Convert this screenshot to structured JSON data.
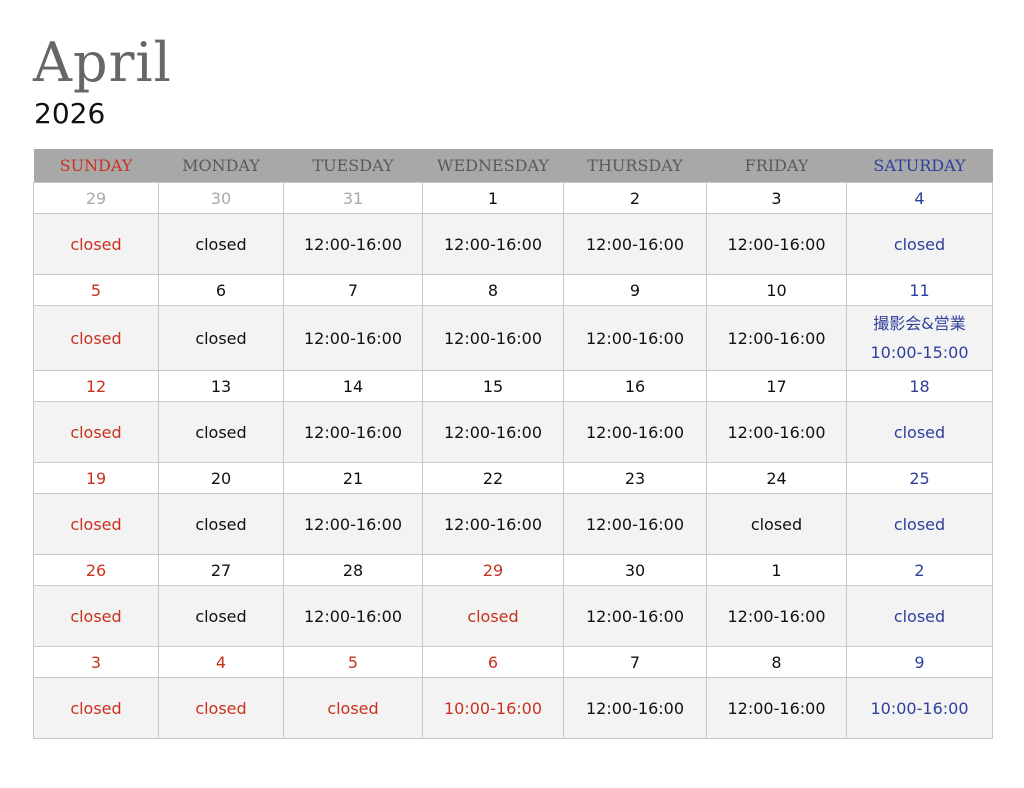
{
  "title": {
    "month": "April",
    "year": "2026"
  },
  "weekdays": [
    "SUNDAY",
    "MONDAY",
    "TUESDAY",
    "WEDNESDAY",
    "THURSDAY",
    "FRIDAY",
    "SATURDAY"
  ],
  "colors": {
    "holiday_red": "#c8321e",
    "saturday_blue": "#2e3f9c",
    "other_month_grey": "#a9a9a9",
    "header_bg": "#a8a8a8",
    "hours_bg": "#f3f3f3"
  },
  "weeks": [
    {
      "days": [
        {
          "date": "29",
          "hours": "closed",
          "date_color": "grey",
          "hours_color": "red"
        },
        {
          "date": "30",
          "hours": "closed",
          "date_color": "grey",
          "hours_color": "default"
        },
        {
          "date": "31",
          "hours": "12:00-16:00",
          "date_color": "grey",
          "hours_color": "default"
        },
        {
          "date": "1",
          "hours": "12:00-16:00",
          "date_color": "default",
          "hours_color": "default"
        },
        {
          "date": "2",
          "hours": "12:00-16:00",
          "date_color": "default",
          "hours_color": "default"
        },
        {
          "date": "3",
          "hours": "12:00-16:00",
          "date_color": "default",
          "hours_color": "default"
        },
        {
          "date": "4",
          "hours": "closed",
          "date_color": "blue",
          "hours_color": "blue"
        }
      ]
    },
    {
      "days": [
        {
          "date": "5",
          "hours": "closed",
          "date_color": "red",
          "hours_color": "red"
        },
        {
          "date": "6",
          "hours": "closed",
          "date_color": "default",
          "hours_color": "default"
        },
        {
          "date": "7",
          "hours": "12:00-16:00",
          "date_color": "default",
          "hours_color": "default"
        },
        {
          "date": "8",
          "hours": "12:00-16:00",
          "date_color": "default",
          "hours_color": "default"
        },
        {
          "date": "9",
          "hours": "12:00-16:00",
          "date_color": "default",
          "hours_color": "default"
        },
        {
          "date": "10",
          "hours": "12:00-16:00",
          "date_color": "default",
          "hours_color": "default"
        },
        {
          "date": "11",
          "hours": "撮影会&営業",
          "hours_line2": "10:00-15:00",
          "date_color": "blue",
          "hours_color": "blue"
        }
      ]
    },
    {
      "days": [
        {
          "date": "12",
          "hours": "closed",
          "date_color": "red",
          "hours_color": "red"
        },
        {
          "date": "13",
          "hours": "closed",
          "date_color": "default",
          "hours_color": "default"
        },
        {
          "date": "14",
          "hours": "12:00-16:00",
          "date_color": "default",
          "hours_color": "default"
        },
        {
          "date": "15",
          "hours": "12:00-16:00",
          "date_color": "default",
          "hours_color": "default"
        },
        {
          "date": "16",
          "hours": "12:00-16:00",
          "date_color": "default",
          "hours_color": "default"
        },
        {
          "date": "17",
          "hours": "12:00-16:00",
          "date_color": "default",
          "hours_color": "default"
        },
        {
          "date": "18",
          "hours": "closed",
          "date_color": "blue",
          "hours_color": "blue"
        }
      ]
    },
    {
      "days": [
        {
          "date": "19",
          "hours": "closed",
          "date_color": "red",
          "hours_color": "red"
        },
        {
          "date": "20",
          "hours": "closed",
          "date_color": "default",
          "hours_color": "default"
        },
        {
          "date": "21",
          "hours": "12:00-16:00",
          "date_color": "default",
          "hours_color": "default"
        },
        {
          "date": "22",
          "hours": "12:00-16:00",
          "date_color": "default",
          "hours_color": "default"
        },
        {
          "date": "23",
          "hours": "12:00-16:00",
          "date_color": "default",
          "hours_color": "default"
        },
        {
          "date": "24",
          "hours": "closed",
          "date_color": "default",
          "hours_color": "default"
        },
        {
          "date": "25",
          "hours": "closed",
          "date_color": "blue",
          "hours_color": "blue"
        }
      ]
    },
    {
      "days": [
        {
          "date": "26",
          "hours": "closed",
          "date_color": "red",
          "hours_color": "red"
        },
        {
          "date": "27",
          "hours": "closed",
          "date_color": "default",
          "hours_color": "default"
        },
        {
          "date": "28",
          "hours": "12:00-16:00",
          "date_color": "default",
          "hours_color": "default"
        },
        {
          "date": "29",
          "hours": "closed",
          "date_color": "red",
          "hours_color": "red"
        },
        {
          "date": "30",
          "hours": "12:00-16:00",
          "date_color": "default",
          "hours_color": "default"
        },
        {
          "date": "1",
          "hours": "12:00-16:00",
          "date_color": "default",
          "hours_color": "default"
        },
        {
          "date": "2",
          "hours": "closed",
          "date_color": "blue",
          "hours_color": "blue"
        }
      ]
    },
    {
      "days": [
        {
          "date": "3",
          "hours": "closed",
          "date_color": "red",
          "hours_color": "red"
        },
        {
          "date": "4",
          "hours": "closed",
          "date_color": "red",
          "hours_color": "red"
        },
        {
          "date": "5",
          "hours": "closed",
          "date_color": "red",
          "hours_color": "red"
        },
        {
          "date": "6",
          "hours": "10:00-16:00",
          "date_color": "red",
          "hours_color": "red"
        },
        {
          "date": "7",
          "hours": "12:00-16:00",
          "date_color": "default",
          "hours_color": "default"
        },
        {
          "date": "8",
          "hours": "12:00-16:00",
          "date_color": "default",
          "hours_color": "default"
        },
        {
          "date": "9",
          "hours": "10:00-16:00",
          "date_color": "blue",
          "hours_color": "blue"
        }
      ]
    }
  ]
}
